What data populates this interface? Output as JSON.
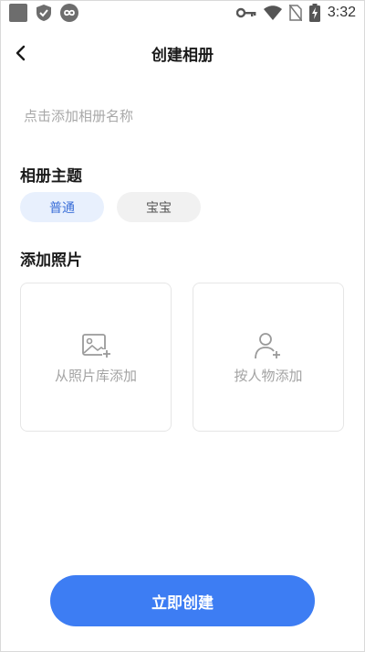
{
  "status_bar": {
    "time": "3:32",
    "icons": [
      "gallery-icon",
      "shield-check-icon",
      "infinity-icon",
      "key-icon",
      "wifi-icon",
      "no-sim-icon",
      "battery-charging-icon"
    ]
  },
  "header": {
    "title": "创建相册"
  },
  "name_input": {
    "placeholder": "点击添加相册名称",
    "value": ""
  },
  "theme": {
    "title": "相册主题",
    "options": [
      "普通",
      "宝宝"
    ],
    "selected": "普通"
  },
  "photos": {
    "title": "添加照片",
    "add_from_library": "从照片库添加",
    "add_by_person": "按人物添加"
  },
  "create_button": {
    "label": "立即创建"
  },
  "colors": {
    "accent": "#3d7df3",
    "chip_selected_bg": "#e8f0fd",
    "chip_selected_text": "#3b6fd8"
  }
}
